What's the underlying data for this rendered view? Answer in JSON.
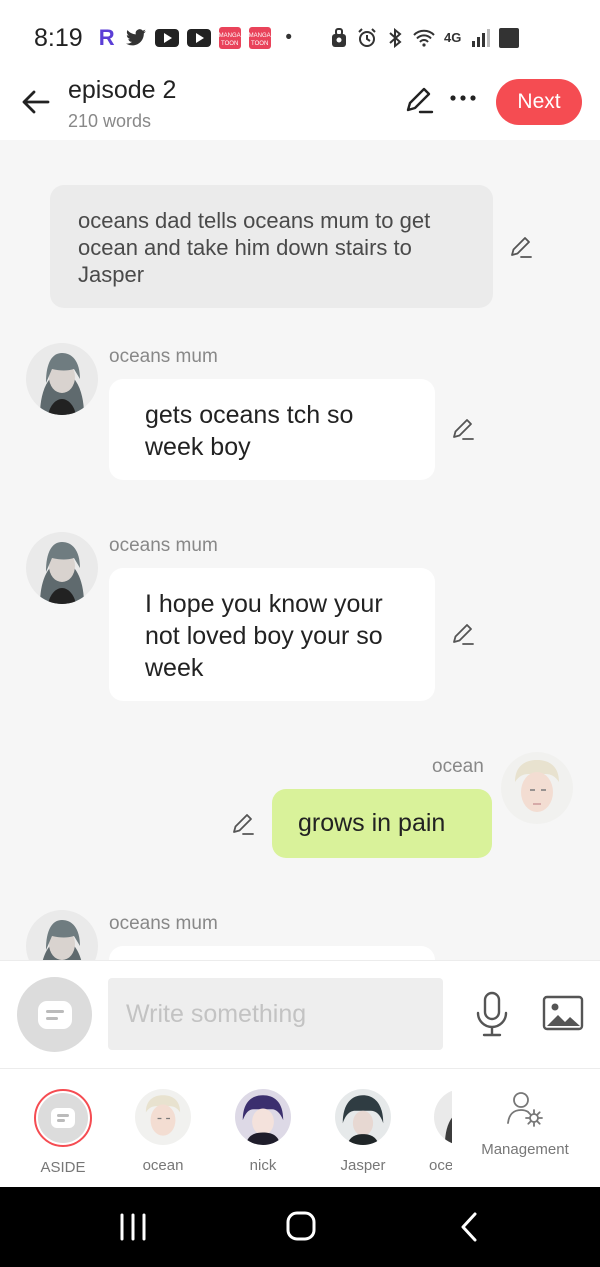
{
  "status_bar": {
    "time": "8:19",
    "left_icons": [
      "r-app-icon",
      "twitter-icon",
      "youtube-icon",
      "youtube-icon",
      "mangatoon-icon",
      "mangatoon-icon",
      "dot-icon"
    ],
    "manga_label": "MANGA TOON",
    "network_label": "4G"
  },
  "header": {
    "title": "episode 2",
    "word_count": "210 words",
    "next_label": "Next",
    "accent_color": "#f54c52"
  },
  "chat": {
    "narration": "oceans dad tells oceans mum to get ocean and take him down stairs to Jasper",
    "messages": [
      {
        "speaker": "oceans mum",
        "text": "gets oceans tch so week boy"
      },
      {
        "speaker": "oceans mum",
        "text": "I hope you know your not loved boy your so week"
      },
      {
        "speaker": "ocean",
        "text": "grows in pain"
      },
      {
        "speaker": "oceans mum",
        "text": ""
      }
    ]
  },
  "composer": {
    "placeholder": "Write something"
  },
  "characters": [
    {
      "name": "ASIDE"
    },
    {
      "name": "ocean"
    },
    {
      "name": "nick"
    },
    {
      "name": "Jasper"
    },
    {
      "name": "oce"
    }
  ],
  "management_label": "Management"
}
